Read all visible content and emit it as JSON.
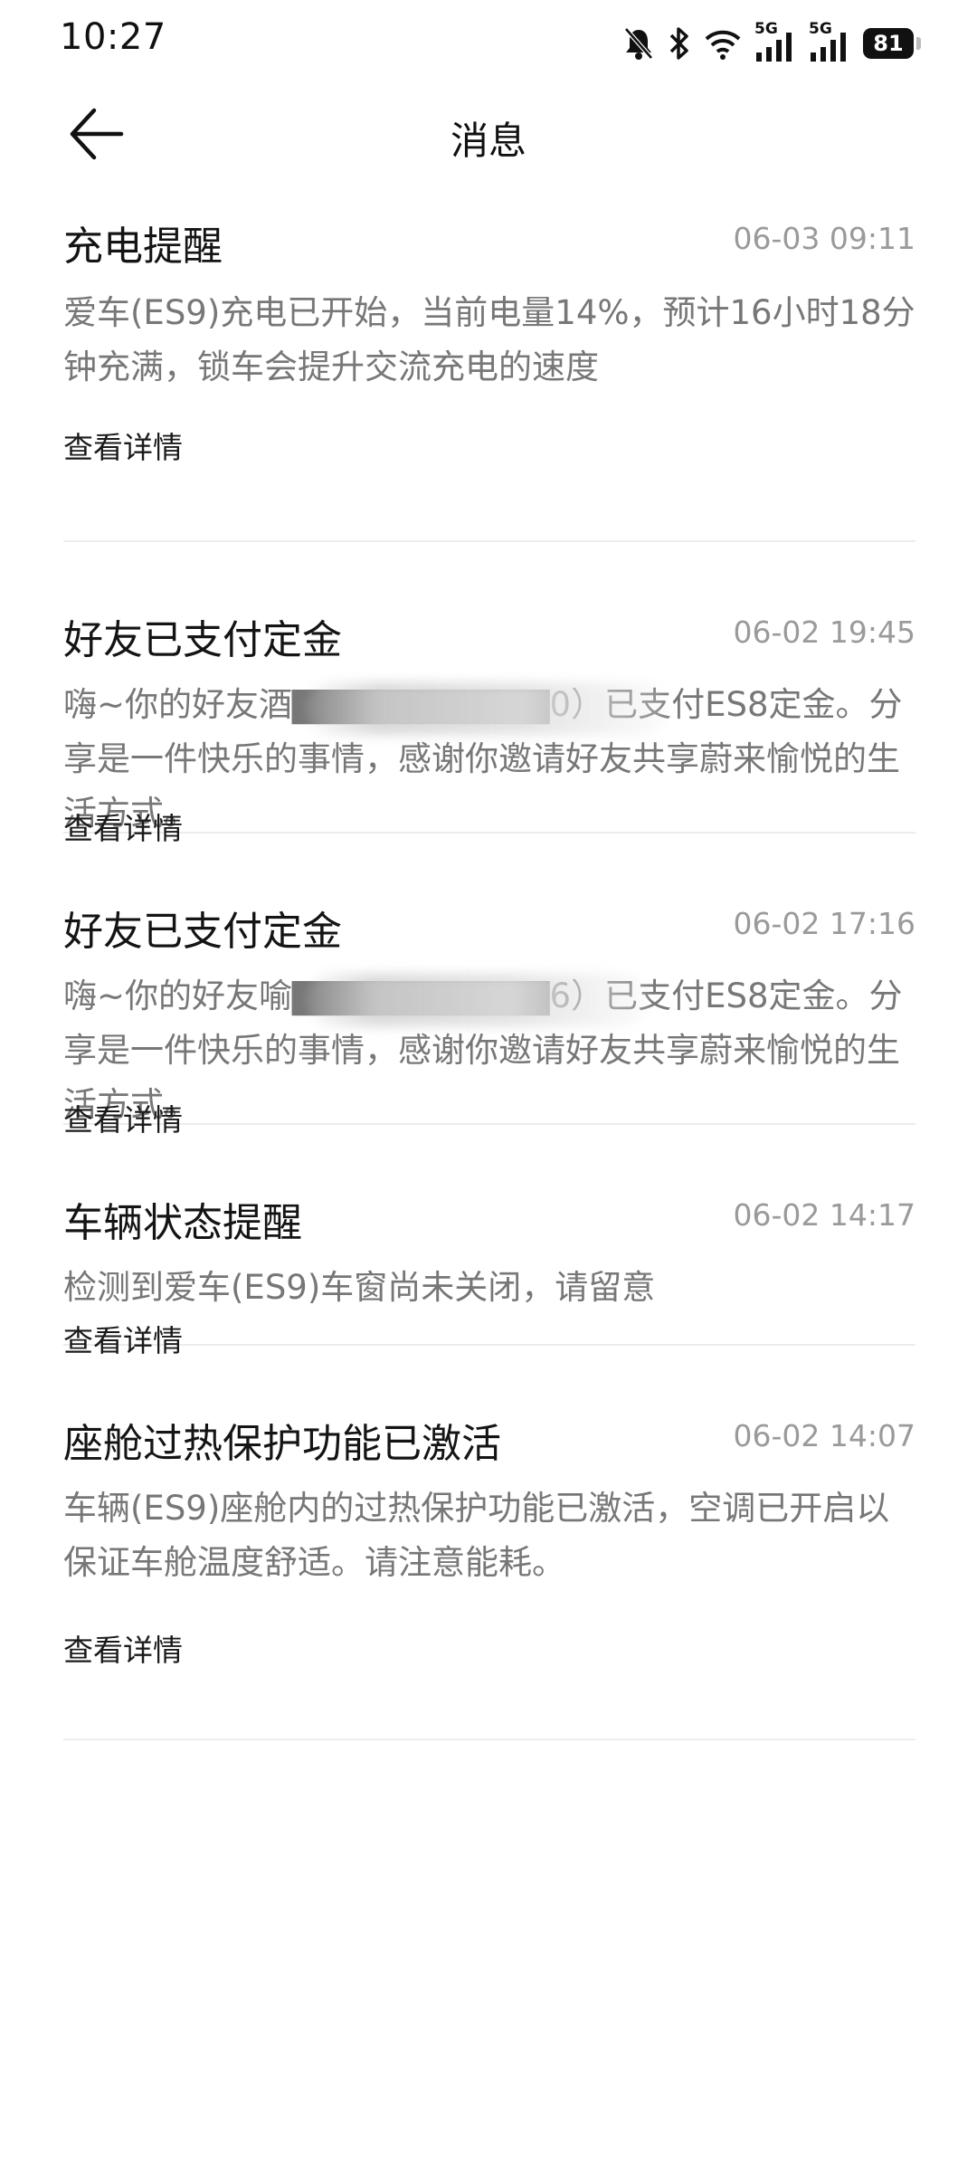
{
  "status_bar": {
    "time": "10:27",
    "battery": "81",
    "network_1": "5G",
    "network_2": "5G",
    "icons": [
      "mute-bell-icon",
      "bluetooth-icon",
      "wifi-icon",
      "signal-icon",
      "signal-icon",
      "battery-icon"
    ]
  },
  "header": {
    "title": "消息",
    "back_icon": "back-arrow-icon"
  },
  "messages": [
    {
      "title": "充电提醒",
      "time": "06-03 09:11",
      "body": "爱车(ES9)充电已开始，当前电量14%，预计16小时18分钟充满，锁车会提升交流充电的速度",
      "link": "查看详情"
    },
    {
      "title": "好友已支付定金",
      "time": "06-02 19:45",
      "body": "嗨~你的好友酒▇▇▇▇▇▇▇▇▇▇0）已支付ES8定金。分享是一件快乐的事情，感谢你邀请好友共享蔚来愉悦的生活方式。",
      "link": "查看详情"
    },
    {
      "title": "好友已支付定金",
      "time": "06-02 17:16",
      "body": "嗨~你的好友喻▇▇▇▇▇▇▇▇▇▇6）已支付ES8定金。分享是一件快乐的事情，感谢你邀请好友共享蔚来愉悦的生活方式。",
      "link": "查看详情"
    },
    {
      "title": "车辆状态提醒",
      "time": "06-02 14:17",
      "body": "检测到爱车(ES9)车窗尚未关闭，请留意",
      "link": "查看详情"
    },
    {
      "title": "座舱过热保护功能已激活",
      "time": "06-02 14:07",
      "body": "车辆(ES9)座舱内的过热保护功能已激活，空调已开启以保证车舱温度舒适。请注意能耗。",
      "link": "查看详情"
    }
  ]
}
